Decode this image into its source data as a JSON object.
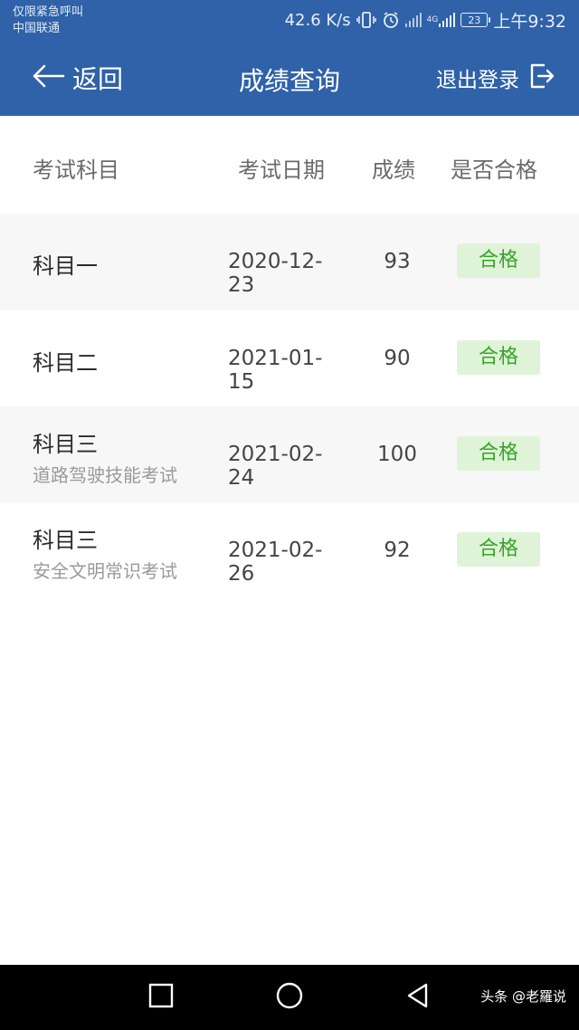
{
  "status_bar": {
    "carrier_line1": "仅限紧急呼叫",
    "carrier_line2": "中国联通",
    "net_speed": "42.6 K/s",
    "network_label": "4G",
    "battery": "23",
    "time": "上午9:32"
  },
  "navbar": {
    "back_label": "返回",
    "title": "成绩查询",
    "logout_label": "退出登录",
    "bg_color": "#2f62a8"
  },
  "table": {
    "headers": [
      "考试科目",
      "考试日期",
      "成绩",
      "是否合格"
    ],
    "rows": [
      {
        "subject": "科目一",
        "detail": "",
        "date": "2020-12-23",
        "score": "93",
        "status": "合格"
      },
      {
        "subject": "科目二",
        "detail": "",
        "date": "2021-01-15",
        "score": "90",
        "status": "合格"
      },
      {
        "subject": "科目三",
        "detail": "道路驾驶技能考试",
        "date": "2021-02-24",
        "score": "100",
        "status": "合格"
      },
      {
        "subject": "科目三",
        "detail": "安全文明常识考试",
        "date": "2021-02-26",
        "score": "92",
        "status": "合格"
      }
    ],
    "pass_color": "#38a428",
    "pass_bg": "#dff3d8"
  },
  "watermark": "头条 @老羅说"
}
